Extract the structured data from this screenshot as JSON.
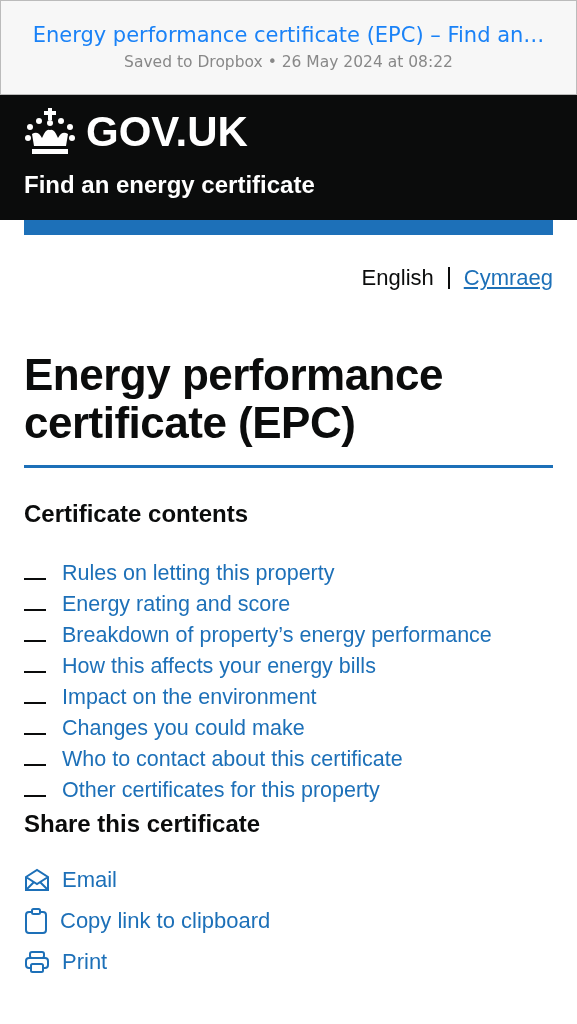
{
  "saved_bar": {
    "title": "Energy performance certificate (EPC) – Find an…",
    "subtitle": "Saved to Dropbox • 26 May 2024 at 08:22"
  },
  "header": {
    "logo": "GOV.UK",
    "service": "Find an energy certificate"
  },
  "languages": [
    {
      "label": "English",
      "selected": true
    },
    {
      "label": "Cymraeg",
      "selected": false
    }
  ],
  "heading": "Energy performance certificate (EPC)",
  "contents": {
    "title": "Certificate contents",
    "items": [
      "Rules on letting this property",
      "Energy rating and score",
      "Breakdown of property’s energy performance",
      "How this affects your energy bills",
      "Impact on the environment",
      "Changes you could make",
      "Who to contact about this certificate",
      "Other certificates for this property"
    ]
  },
  "share": {
    "title": "Share this certificate",
    "items": [
      {
        "kind": "email",
        "label": "Email"
      },
      {
        "kind": "copy",
        "label": "Copy link to clipboard"
      },
      {
        "kind": "print",
        "label": "Print"
      }
    ]
  }
}
